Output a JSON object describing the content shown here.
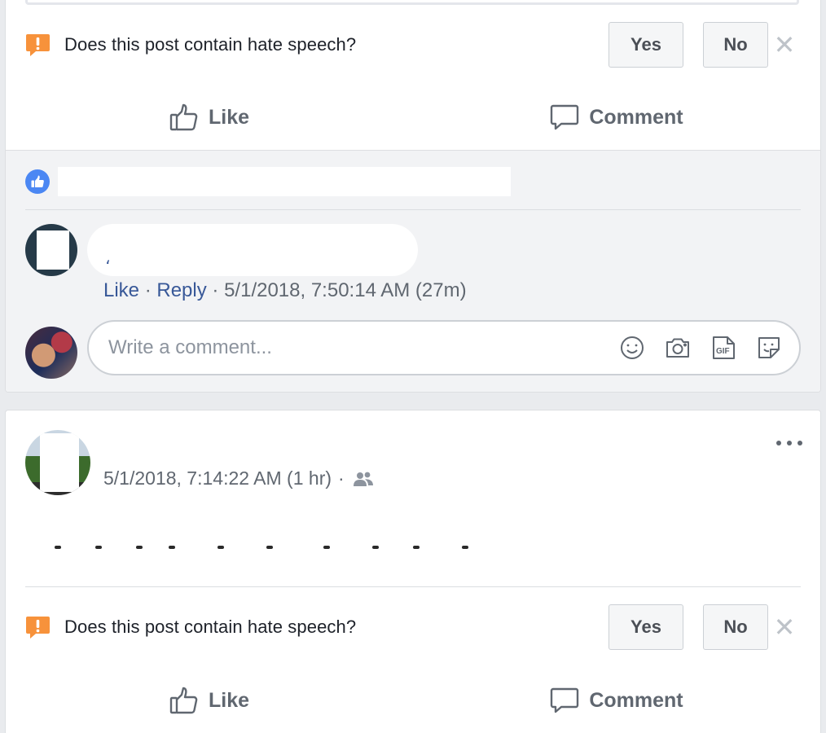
{
  "hate_prompt": {
    "question": "Does this post contain hate speech?",
    "yes_label": "Yes",
    "no_label": "No",
    "dismiss_glyph": "✕",
    "warning_color": "#f7923b"
  },
  "actions": {
    "like_label": "Like",
    "comment_label": "Comment"
  },
  "comment": {
    "text": "،",
    "like_link": "Like",
    "separator": "·",
    "reply_link": "Reply",
    "timestamp": "5/1/2018, 7:50:14 AM (27m)"
  },
  "composer": {
    "placeholder": "Write a comment...",
    "tools": [
      "emoji-icon",
      "camera-icon",
      "gif-icon",
      "sticker-icon"
    ]
  },
  "post2": {
    "timestamp": "5/1/2018, 7:14:22 AM (1 hr)",
    "separator": "·",
    "audience_icon": "friends-icon"
  },
  "colors": {
    "link": "#385898",
    "reaction_blue": "#4b87f3",
    "muted_text": "#606770"
  }
}
